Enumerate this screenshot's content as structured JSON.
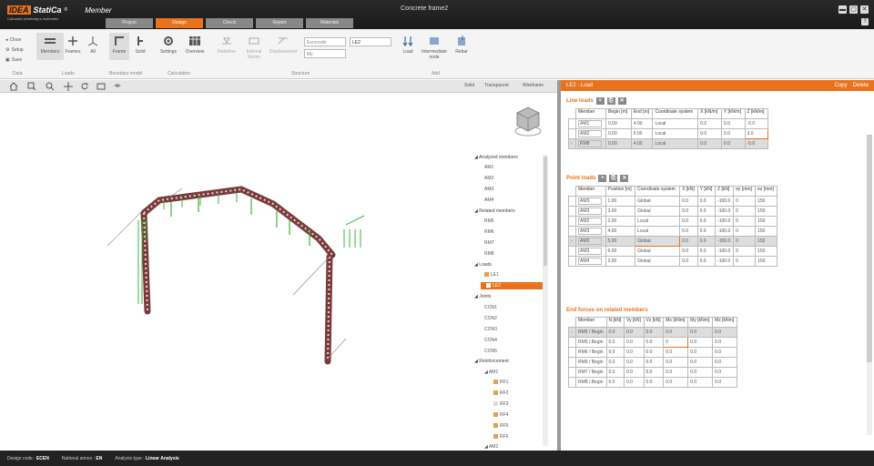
{
  "app": {
    "brand_idea": "IDEA",
    "brand_statica": "StatiCa",
    "registered": "®",
    "app_name": "Member",
    "tagline": "Calculate yesterday's estimates",
    "window_title": "Concrete frame2"
  },
  "tabs": [
    {
      "label": "Project"
    },
    {
      "label": "Design"
    },
    {
      "label": "Check"
    },
    {
      "label": "Report"
    },
    {
      "label": "Materials"
    }
  ],
  "window_buttons": {
    "minimize": "▬",
    "maximize": "▢",
    "close": "✕",
    "help": "?"
  },
  "ribbon": {
    "file": {
      "close": "Close",
      "setup": "Setup",
      "save": "Save",
      "group": "Data"
    },
    "loads_group": {
      "members": "Members",
      "frames": "Frames",
      "all": "All",
      "group": "Loads"
    },
    "boundary": {
      "frame": "Frame",
      "solid": "Solid",
      "group": "Boundary model"
    },
    "calculation": {
      "settings": "Settings",
      "overview": "Overview",
      "group": "Calculation"
    },
    "structure": {
      "item1": "Redefine",
      "item2": "Internal forces",
      "item3": "Displacement",
      "item4": "Loads",
      "group": "Structure"
    },
    "loads": {
      "code_value": "Eurocode",
      "type_value": "My",
      "lc_value": "LE2",
      "group": "Loads"
    },
    "members": {
      "load": "Load",
      "intermediate": "Intermediate node",
      "rebar": "Rebar",
      "group": "Add"
    }
  },
  "view_toolbar": {
    "modes": [
      "Solid",
      "Transparent",
      "Wireframe"
    ]
  },
  "tree": {
    "analyzed_header": "Analyzed members",
    "analyzed": [
      "AM1",
      "AM2",
      "AM3",
      "AM4"
    ],
    "related_header": "Related members",
    "related": [
      "RM5",
      "RM6",
      "RM7",
      "RM8"
    ],
    "loads_header": "Loads",
    "loads": [
      "LE1",
      "LE2"
    ],
    "joints_header": "Joints",
    "joints": [
      "CON1",
      "CON2",
      "CON3",
      "CON4",
      "CON5"
    ],
    "reinforcement_header": "Reinforcement",
    "am1": "AM1",
    "rebars": [
      "RF1",
      "RF2",
      "RF3",
      "RF4",
      "RF5",
      "RF6"
    ],
    "am2": "AM2"
  },
  "right_panel": {
    "title": "LE2 - Load",
    "actions": [
      "Copy",
      "Delete"
    ],
    "line_loads": {
      "title": "Line loads",
      "headers": [
        "Member",
        "Begin [m]",
        "End [m]",
        "Coordinate system",
        "X [kN/m]",
        "Y [kN/m]",
        "Z [kN/m]"
      ],
      "rows": [
        [
          "AM1",
          "0.00",
          "4.00",
          "Local",
          "0.0",
          "0.0",
          "-5.0"
        ],
        [
          "AM2",
          "0.00",
          "6.00",
          "Local",
          "0.0",
          "0.0",
          "3.0"
        ],
        [
          "RM8",
          "0.00",
          "4.00",
          "Local",
          "0.0",
          "0.0",
          "-5.0"
        ]
      ]
    },
    "point_loads": {
      "title": "Point loads",
      "headers": [
        "Member",
        "Position [m]",
        "Coordinate system",
        "X [kN]",
        "Y [kN]",
        "Z [kN]",
        "ey [mm]",
        "ez [mm]"
      ],
      "rows": [
        [
          "AM3",
          "1.00",
          "Global",
          "0.0",
          "0.0",
          "-100.0",
          "0",
          "150"
        ],
        [
          "AM3",
          "3.00",
          "Global",
          "0.0",
          "0.0",
          "-100.0",
          "0",
          "150"
        ],
        [
          "AM2",
          "2.00",
          "Local",
          "0.0",
          "0.0",
          "-100.0",
          "0",
          "150"
        ],
        [
          "AM3",
          "4.00",
          "Local",
          "0.0",
          "0.0",
          "-100.0",
          "0",
          "150"
        ],
        [
          "AM3",
          "5.00",
          "Global",
          "0.0",
          "0.0",
          "-100.0",
          "0",
          "150"
        ],
        [
          "AM3",
          "6.00",
          "Global",
          "0.0",
          "0.0",
          "-100.0",
          "0",
          "150"
        ],
        [
          "AM4",
          "2.00",
          "Global",
          "0.0",
          "0.0",
          "-100.0",
          "0",
          "150"
        ]
      ]
    },
    "end_forces": {
      "title": "End forces on related members",
      "headers": [
        "Member",
        "N [kN]",
        "Vy [kN]",
        "Vz [kN]",
        "Mx [kNm]",
        "My [kNm]",
        "Mz [kNm]"
      ],
      "rows": [
        [
          "RM5 / Begin",
          "0.0",
          "0.0",
          "0.0",
          "0.0",
          "0.0",
          "0.0"
        ],
        [
          "RM5 / Begin",
          "0.0",
          "0.0",
          "0.0",
          "0",
          "0.0",
          "0.0"
        ],
        [
          "RM6 / Begin",
          "0.0",
          "0.0",
          "0.0",
          "0.0",
          "0.0",
          "0.0"
        ],
        [
          "RM6 / Begin",
          "0.0",
          "0.0",
          "0.0",
          "0.0",
          "0.0",
          "0.0"
        ],
        [
          "RM7 / Begin",
          "0.0",
          "0.0",
          "0.0",
          "0.0",
          "0.0",
          "0.0"
        ],
        [
          "RM8 / Begin",
          "0.0",
          "0.0",
          "0.0",
          "0.0",
          "0.0",
          "0.0"
        ]
      ]
    }
  },
  "status": {
    "design_code_label": "Design code :",
    "design_code": "ECEN",
    "annex_label": "National annex :",
    "annex": "EN",
    "analysis_label": "Analysis type :",
    "analysis": "Linear Analysis"
  },
  "colors": {
    "accent": "#e8731c",
    "dark": "#1a1a1a"
  }
}
